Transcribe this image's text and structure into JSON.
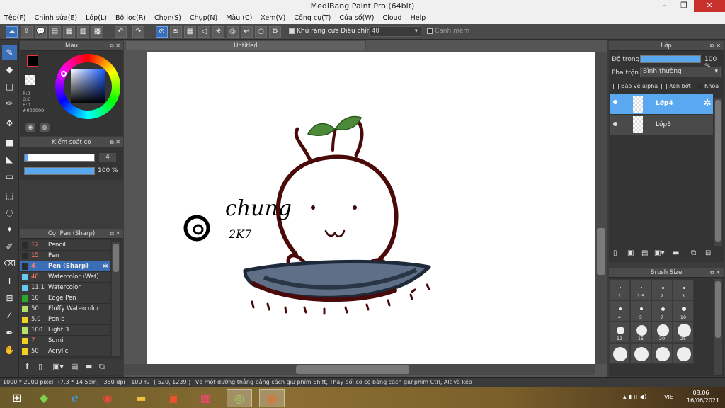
{
  "window": {
    "title": "MediBang Paint Pro (64bit)",
    "minimize": "–",
    "restore": "❐",
    "close": "✕"
  },
  "menu": [
    "Tệp(F)",
    "Chỉnh sửa(E)",
    "Lớp(L)",
    "Bộ lọc(R)",
    "Chọn(S)",
    "Chụp(N)",
    "Màu (C)",
    "Xem(V)",
    "Công cụ(T)",
    "Cửa số(W)",
    "Cloud",
    "Help"
  ],
  "toolbar": {
    "antialias_label": "Khử răng cưa",
    "adjust_label": "Điều chỉnh",
    "adjust_value": "40",
    "margin_label": "Canh mềm"
  },
  "color_panel": {
    "title": "Màu",
    "r": "R:0",
    "g": "G:0",
    "b": "B:0",
    "hex": "#000000"
  },
  "brush_control": {
    "title": "Kiểm soát cọ",
    "size": "4",
    "opacity": "100 %"
  },
  "brush_panel": {
    "title": "Cọ: Pen (Sharp)",
    "items": [
      {
        "size": "12",
        "name": "Pencil",
        "color": "#2b2b2b"
      },
      {
        "size": "15",
        "name": "Pen",
        "color": "#2b2b2b"
      },
      {
        "size": "4",
        "name": "Pen (Sharp)",
        "color": "#2b2b2b"
      },
      {
        "size": "40",
        "name": "Watercolor (Wet)",
        "color": "#67c9f0"
      },
      {
        "size": "11.1",
        "name": "Watercolor",
        "color": "#67c9f0"
      },
      {
        "size": "10",
        "name": "Edge Pen",
        "color": "#2da82d"
      },
      {
        "size": "50",
        "name": "Fluffy Watercolor",
        "color": "#b5e06a"
      },
      {
        "size": "5.0",
        "name": "Pen b",
        "color": "#f0d020"
      },
      {
        "size": "100",
        "name": "Light 3",
        "color": "#b5e06a"
      },
      {
        "size": "7",
        "name": "Sumi",
        "color": "#f0d020"
      },
      {
        "size": "50",
        "name": "Acrylic",
        "color": "#f0d020"
      }
    ]
  },
  "document": {
    "tab": "Untitled"
  },
  "layer_panel": {
    "title": "Lớp",
    "opacity_label": "Độ trong",
    "opacity_value": "100 %",
    "blend_label": "Pha trộn",
    "blend_value": "Bình thường",
    "protect_alpha": "Bảo vệ alpha",
    "clipping": "Xén bớt",
    "lock": "Khóa",
    "layers": [
      {
        "name": "Lớp4",
        "selected": true
      },
      {
        "name": "Lớp3",
        "selected": false
      }
    ]
  },
  "brush_size_panel": {
    "title": "Brush Size",
    "sizes": [
      "1",
      "1.5",
      "2",
      "3",
      "4",
      "5",
      "7",
      "10",
      "12",
      "15",
      "20",
      "25",
      "",
      "",
      "",
      ""
    ]
  },
  "status": {
    "dims": "1000 * 2000 pixel",
    "phys": "(7.3 * 14.5cm)",
    "dpi": "350 dpi",
    "zoom": "100 %",
    "coords": "( 520, 1239 )",
    "hint": "Vẽ một đường thẳng bằng cách giữ phím Shift, Thay đổi cỡ cọ bằng cách giữ phím Ctrl, Alt và kéo"
  },
  "taskbar": {
    "lang": "VIE",
    "time": "08:06",
    "date": "16/06/2021"
  },
  "sketch": {
    "signature_name": "chung",
    "signature_year": "2K7"
  }
}
